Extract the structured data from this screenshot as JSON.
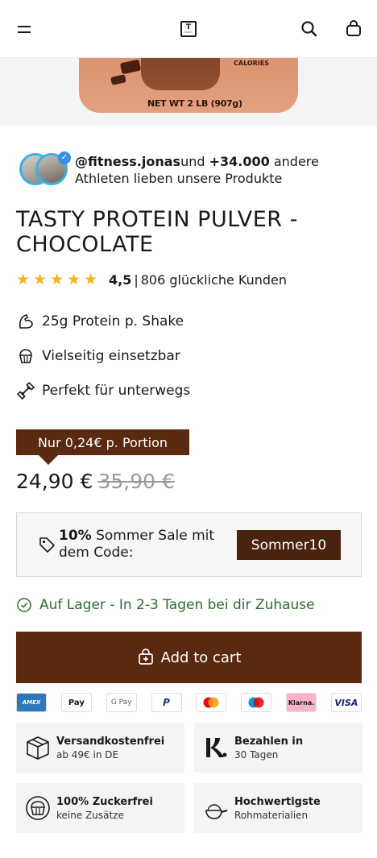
{
  "header": {
    "logo_text": "T",
    "logo_sub": "TASTY"
  },
  "hero": {
    "calories_label": "CALORIES",
    "net_weight": "NET WT 2 LB (907g)"
  },
  "social": {
    "handle": "@fitness.jonas",
    "und": "und",
    "count": "+34.000",
    "rest": "andere Athleten lieben unsere Produkte"
  },
  "product": {
    "title": "TASTY PROTEIN PULVER - CHOCOLATE"
  },
  "rating": {
    "stars": 5,
    "value": "4,5",
    "separator": "|",
    "text": "806 glückliche Kunden"
  },
  "features": [
    {
      "icon": "flexed-arm-icon",
      "label": "25g Protein p. Shake"
    },
    {
      "icon": "cupcake-icon",
      "label": "Vielseitig einsetzbar"
    },
    {
      "icon": "dumbbell-icon",
      "label": "Perfekt für unterwegs"
    }
  ],
  "pricing": {
    "portion_label": "Nur 0,24€ p. Portion",
    "price": "24,90 €",
    "old_price": "35,90 €"
  },
  "promo": {
    "percent": "10%",
    "text": "Sommer Sale mit dem Code:",
    "code": "Sommer10"
  },
  "stock": {
    "text": "Auf Lager - In 2-3 Tagen bei dir Zuhause"
  },
  "cart": {
    "label": "Add to cart"
  },
  "payments": [
    {
      "name": "AMEX",
      "bg": "#2e77bc",
      "fg": "#ffffff"
    },
    {
      "name": "Pay",
      "bg": "#ffffff",
      "fg": "#000000"
    },
    {
      "name": "G Pay",
      "bg": "#ffffff",
      "fg": "#5f6368"
    },
    {
      "name": "P",
      "bg": "#ffffff",
      "fg": "#253b80"
    },
    {
      "name": "mastercard",
      "bg": "#ffffff",
      "fg": "#000000"
    },
    {
      "name": "maestro",
      "bg": "#ffffff",
      "fg": "#000000"
    },
    {
      "name": "Klarna.",
      "bg": "#ffb3c7",
      "fg": "#000000"
    },
    {
      "name": "VISA",
      "bg": "#ffffff",
      "fg": "#1a1f71"
    }
  ],
  "usps": [
    {
      "icon": "box-icon",
      "title": "Versandkostenfrei",
      "sub": "ab 49€ in DE"
    },
    {
      "icon": "klarna-k-icon",
      "title": "Bezahlen in",
      "sub": "30 Tagen"
    },
    {
      "icon": "cupcake-icon",
      "title": "100% Zuckerfrei",
      "sub": "keine Zusätze"
    },
    {
      "icon": "scoop-icon",
      "title": "Hochwertigste",
      "sub": "Rohmaterialien"
    }
  ],
  "colors": {
    "brand_brown": "#5a2a10",
    "star_yellow": "#f5b51c",
    "stock_green": "#2e6b30",
    "verified_blue": "#3a8fe8"
  }
}
